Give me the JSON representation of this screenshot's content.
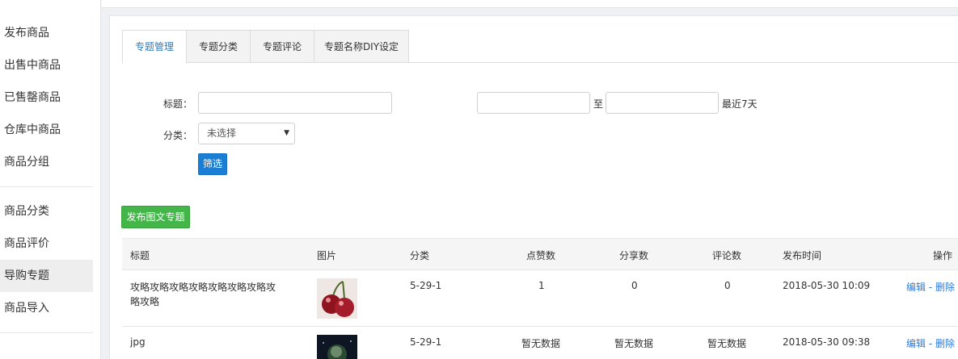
{
  "sidebar": {
    "items": [
      {
        "label": "发布商品"
      },
      {
        "label": "出售中商品"
      },
      {
        "label": "已售罄商品"
      },
      {
        "label": "仓库中商品"
      },
      {
        "label": "商品分组"
      },
      {
        "label": "商品分类"
      },
      {
        "label": "商品评价"
      },
      {
        "label": "导购专题"
      },
      {
        "label": "商品导入"
      }
    ]
  },
  "tabs": [
    {
      "label": "专题管理",
      "active": true
    },
    {
      "label": "专题分类"
    },
    {
      "label": "专题评论"
    },
    {
      "label": "专题名称DIY设定"
    }
  ],
  "filter": {
    "title_label": "标题：",
    "title_value": "",
    "date_from": "",
    "date_sep": "至",
    "date_to": "",
    "recent_link": "最近7天",
    "category_label": "分类：",
    "category_value": "未选择",
    "filter_button": "筛选"
  },
  "publish_button": "发布图文专题",
  "table": {
    "headers": [
      "标题",
      "图片",
      "分类",
      "点赞数",
      "分享数",
      "评论数",
      "发布时间",
      "操作"
    ],
    "rows": [
      {
        "title_line1": "攻略攻略攻略攻略攻略攻略攻略攻",
        "title_line2": "略攻略",
        "category": "5-29-1",
        "likes": "1",
        "shares": "0",
        "comments": "0",
        "time": "2018-05-30 10:09",
        "edit": "编辑",
        "sep": "-",
        "delete": "删除"
      },
      {
        "title_line1": "jpg",
        "category": "5-29-1",
        "likes": "暂无数据",
        "shares": "暂无数据",
        "comments": "暂无数据",
        "time": "2018-05-30 09:38",
        "edit": "编辑",
        "sep": "-",
        "delete": "删除"
      }
    ]
  },
  "colors": {
    "accent": "#337ab7",
    "filter_button": "#1a7fd4",
    "publish_button": "#44b549",
    "link": "#2f7bd5"
  }
}
